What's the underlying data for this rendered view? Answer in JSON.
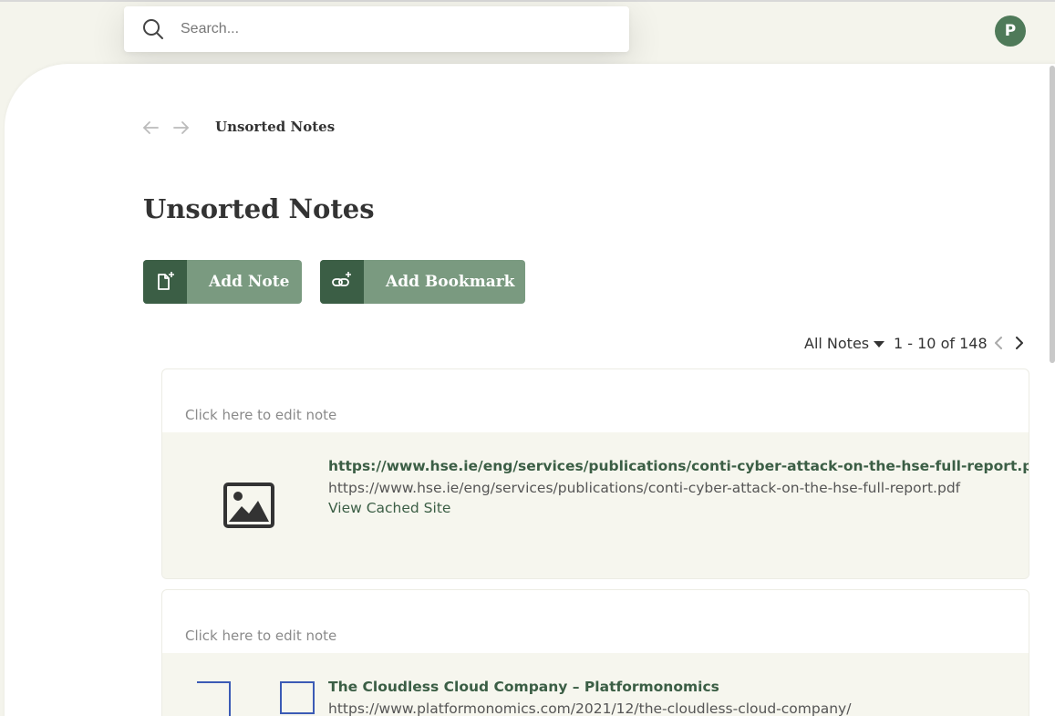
{
  "search": {
    "placeholder": "Search..."
  },
  "user": {
    "avatar_initial": "P"
  },
  "breadcrumb": {
    "current": "Unsorted Notes"
  },
  "page": {
    "title": "Unsorted Notes"
  },
  "actions": {
    "add_note_label": "Add Note",
    "add_bookmark_label": "Add Bookmark"
  },
  "toolbar": {
    "filter_label": "All Notes",
    "pagination": "1 - 10 of 148"
  },
  "notes": [
    {
      "edit_prompt": "Click here to edit note",
      "bookmark": {
        "title": "https://www.hse.ie/eng/services/publications/conti-cyber-attack-on-the-hse-full-report.pdf",
        "url": "https://www.hse.ie/eng/services/publications/conti-cyber-attack-on-the-hse-full-report.pdf",
        "cached_label": "View Cached Site",
        "thumbnail": "image-placeholder-icon"
      }
    },
    {
      "edit_prompt": "Click here to edit note",
      "bookmark": {
        "title": "The Cloudless Cloud Company – Platformonomics",
        "url": "https://www.platformonomics.com/2021/12/the-cloudless-cloud-company/",
        "thumbnail": "site-thumbnail"
      }
    }
  ],
  "colors": {
    "accent_dark": "#3b5e45",
    "accent_light": "#7a9a80",
    "background": "#f4f4ec"
  }
}
